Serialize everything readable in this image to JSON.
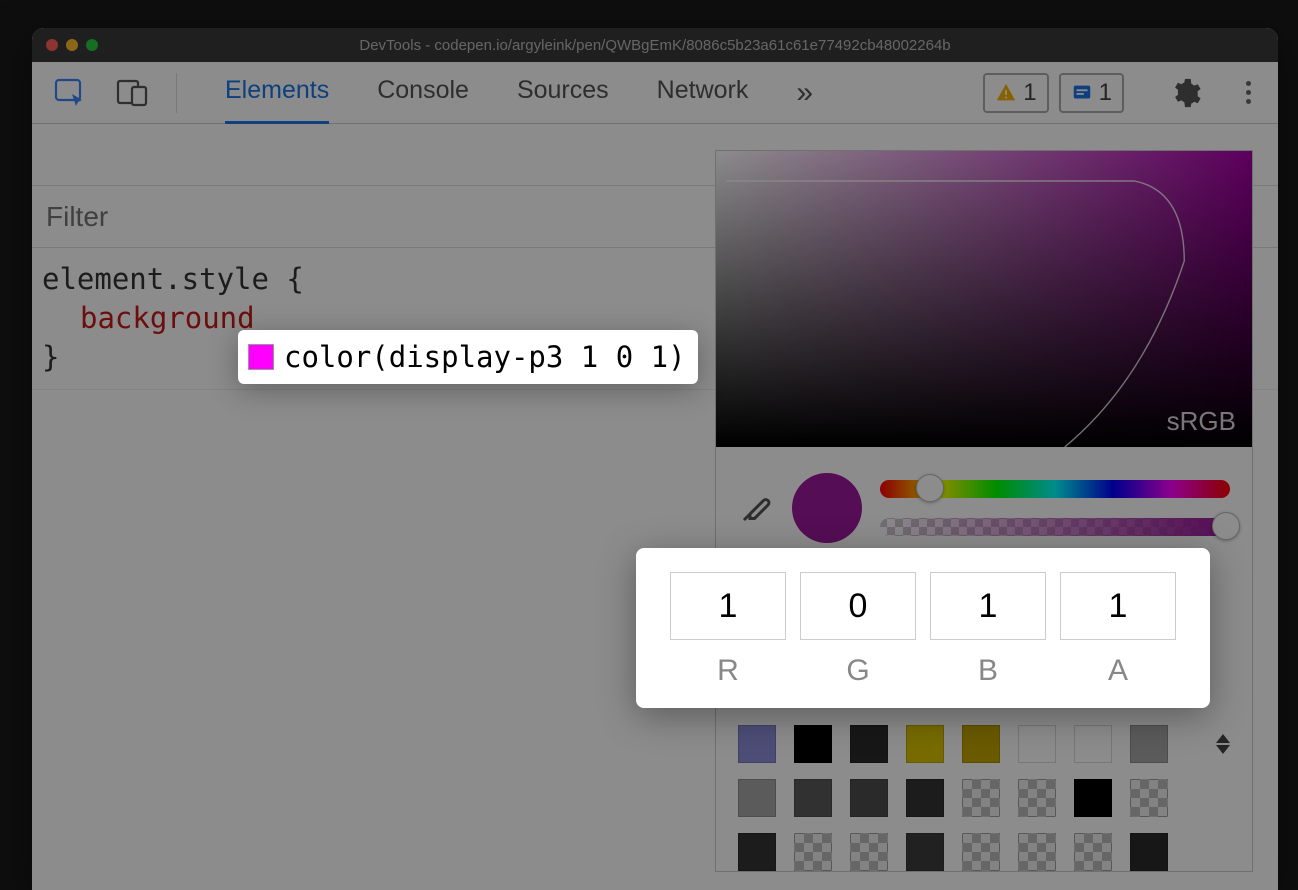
{
  "window": {
    "title": "DevTools - codepen.io/argyleink/pen/QWBgEmK/8086c5b23a61c61e77492cb48002264b"
  },
  "tabs": {
    "items": [
      "Elements",
      "Console",
      "Sources",
      "Network"
    ],
    "active": "Elements",
    "overflow_glyph": "»"
  },
  "badges": {
    "warning_count": "1",
    "issue_count": "1"
  },
  "filter": {
    "placeholder": "Filter"
  },
  "rule": {
    "selector": "element.style {",
    "property": "background",
    "close": "}"
  },
  "swatch_edit": {
    "value": "color(display-p3 1 0 1)",
    "swatch_color": "#ff00ff"
  },
  "colorpicker": {
    "srgb_label": "sRGB",
    "channels": {
      "r": {
        "label": "R",
        "value": "1"
      },
      "g": {
        "label": "G",
        "value": "0"
      },
      "b": {
        "label": "B",
        "value": "1"
      },
      "a": {
        "label": "A",
        "value": "1"
      }
    },
    "palette": [
      [
        "#8c8cd9",
        "#000000",
        "#2b2b2b",
        "#d9c400",
        "#c2a500",
        "#ffffff",
        "#ffffff",
        "#a6a6a6"
      ],
      [
        "#a6a6a6",
        "#595959",
        "#4d4d4d",
        "#333333",
        "checker",
        "checker",
        "#000000",
        "checker"
      ],
      [
        "#333333",
        "checker",
        "checker",
        "#3d3d3d",
        "checker",
        "checker",
        "checker",
        "#2b2b2b"
      ]
    ]
  }
}
